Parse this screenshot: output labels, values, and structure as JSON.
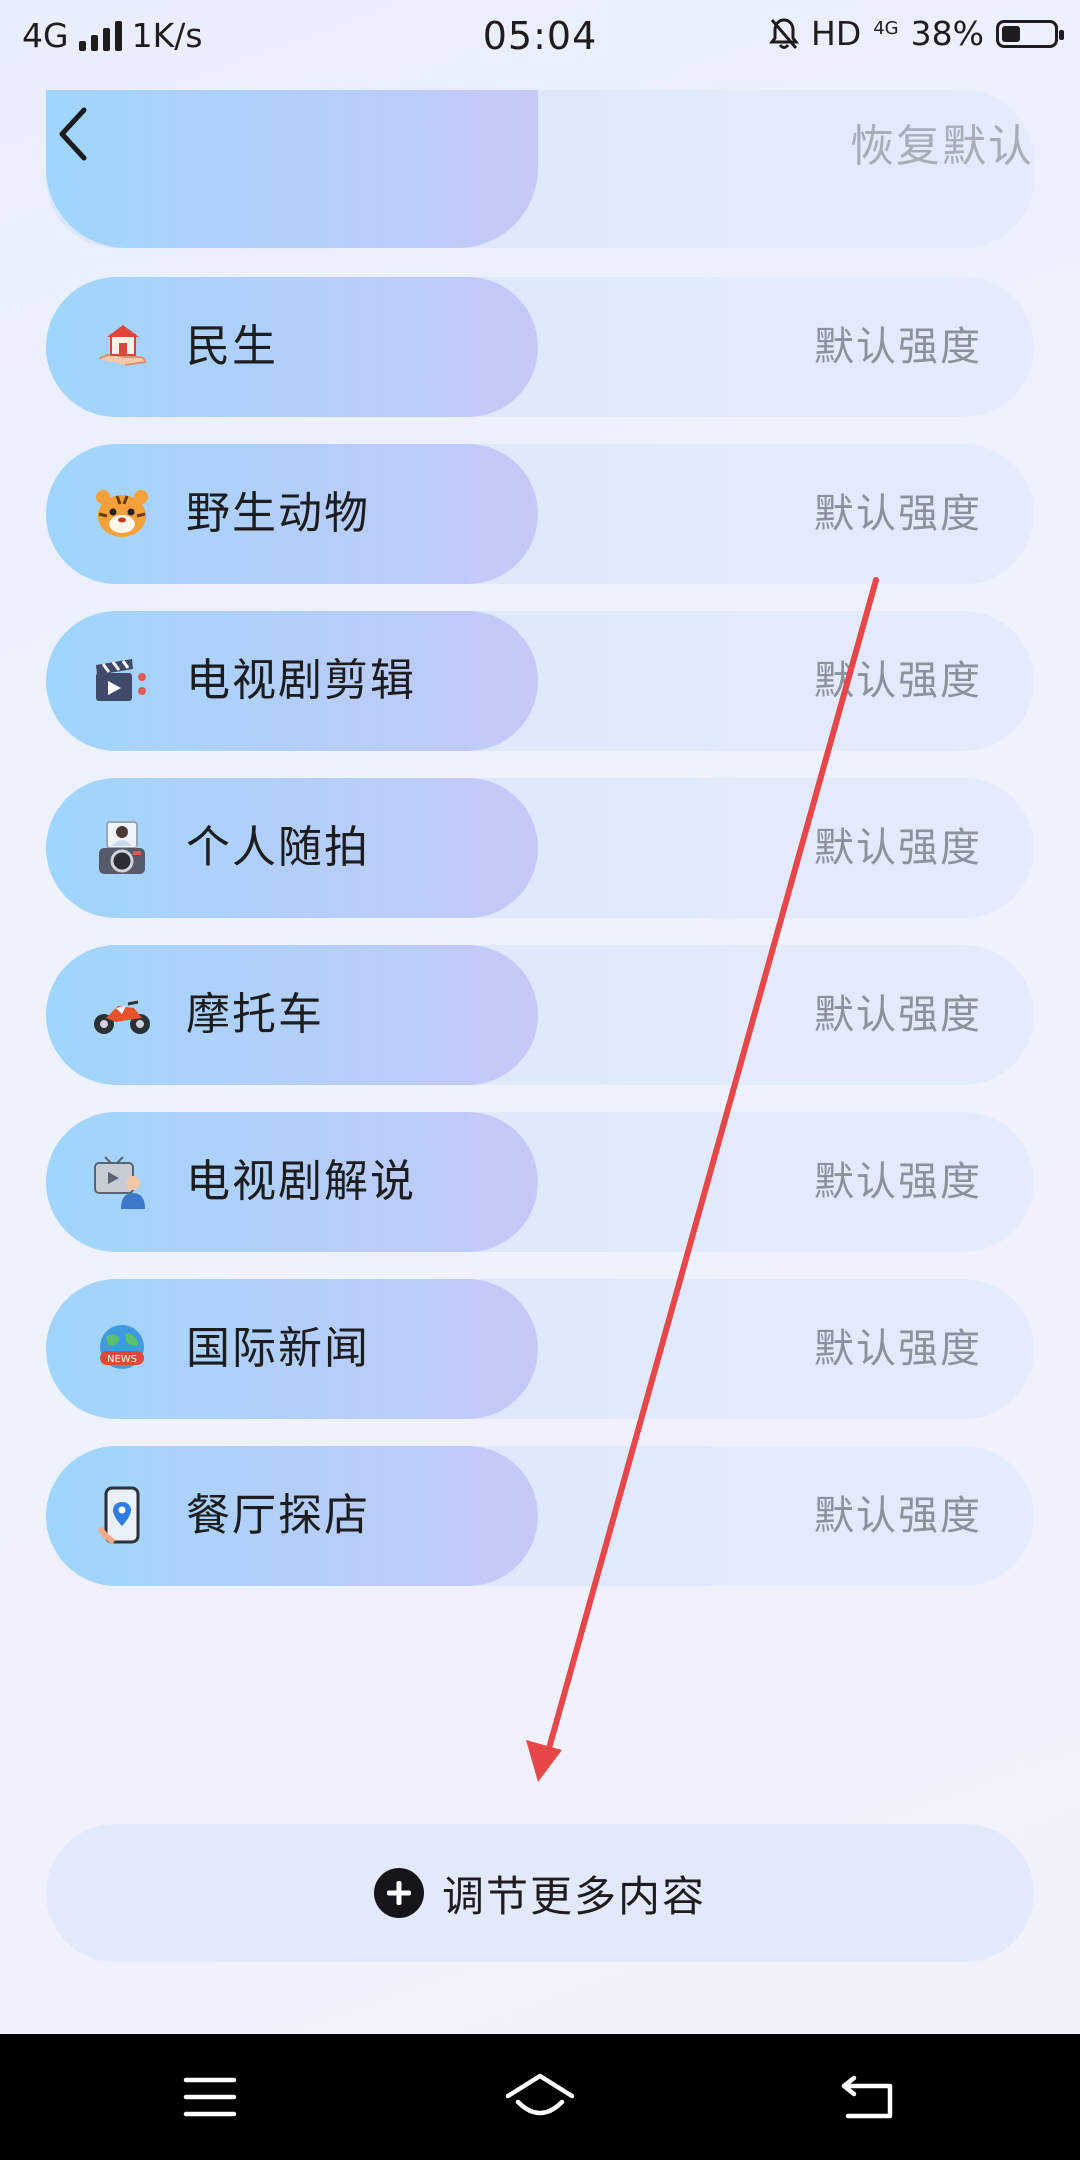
{
  "status_bar": {
    "network": "4G",
    "speed": "1K/s",
    "time": "05:04",
    "hd": "HD",
    "net_type_small": "4G",
    "battery": "38%"
  },
  "header": {
    "reset_label": "恢复默认"
  },
  "rows": [
    {
      "label": "民生",
      "value": "默认强度",
      "icon": "house-in-hand-icon"
    },
    {
      "label": "野生动物",
      "value": "默认强度",
      "icon": "tiger-icon"
    },
    {
      "label": "电视剧剪辑",
      "value": "默认强度",
      "icon": "clapperboard-icon"
    },
    {
      "label": "个人随拍",
      "value": "默认强度",
      "icon": "camera-photo-icon"
    },
    {
      "label": "摩托车",
      "value": "默认强度",
      "icon": "motorcycle-icon"
    },
    {
      "label": "电视剧解说",
      "value": "默认强度",
      "icon": "tv-commentator-icon"
    },
    {
      "label": "国际新闻",
      "value": "默认强度",
      "icon": "globe-news-icon"
    },
    {
      "label": "餐厅探店",
      "value": "默认强度",
      "icon": "phone-location-icon"
    }
  ],
  "more_button": {
    "label": "调节更多内容"
  },
  "colors": {
    "pill_start": "#9fd6fb",
    "pill_end": "#c6c8f7",
    "annotation_arrow": "#e8474a"
  }
}
